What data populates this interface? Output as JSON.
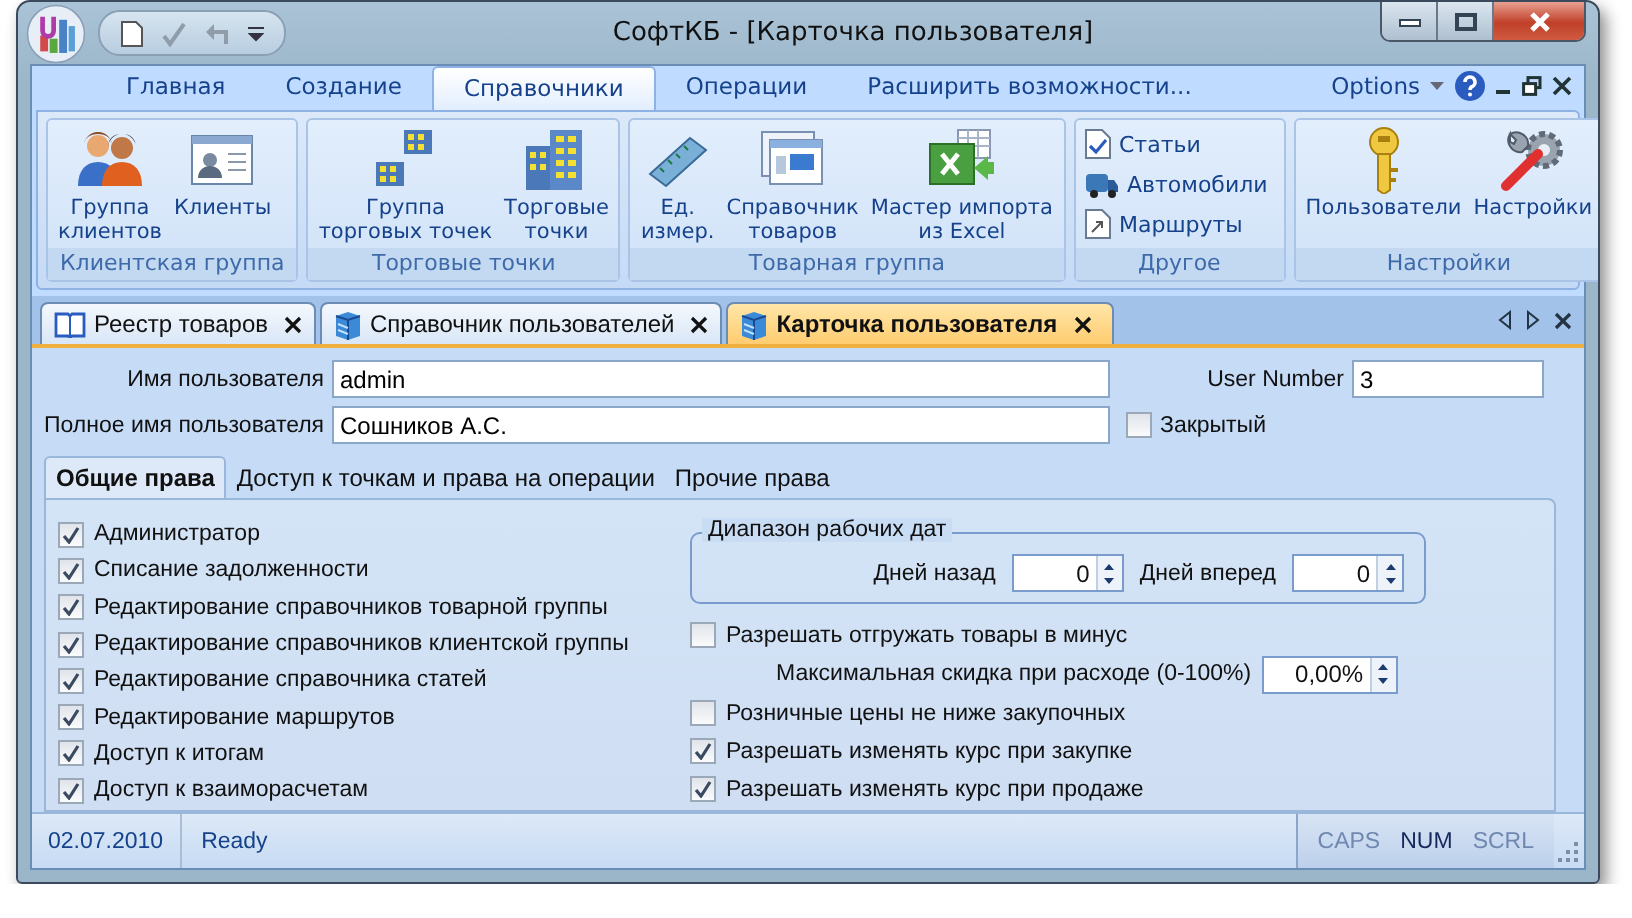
{
  "window": {
    "title": "СофтКБ - [Карточка пользователя]"
  },
  "ribbon_tabs": [
    {
      "label": "Главная",
      "selected": false
    },
    {
      "label": "Создание",
      "selected": false
    },
    {
      "label": "Справочники",
      "selected": true
    },
    {
      "label": "Операции",
      "selected": false
    },
    {
      "label": "Расширить возможности...",
      "selected": false
    }
  ],
  "options": {
    "label": "Options"
  },
  "ribbon_groups": [
    {
      "title": "Клиентская группа",
      "buttons": [
        {
          "kind": "large",
          "label": "Группа\nклиентов"
        },
        {
          "kind": "large",
          "label": "Клиенты"
        }
      ]
    },
    {
      "title": "Торговые точки",
      "buttons": [
        {
          "kind": "large",
          "label": "Группа\nторговых точек"
        },
        {
          "kind": "large",
          "label": "Торговые\nточки"
        }
      ]
    },
    {
      "title": "Товарная группа",
      "buttons": [
        {
          "kind": "large",
          "label": "Ед.\nизмер."
        },
        {
          "kind": "large",
          "label": "Справочник\nтоваров"
        },
        {
          "kind": "large",
          "label": "Мастер импорта\nиз Excel"
        }
      ]
    },
    {
      "title": "Другое",
      "buttons": [
        {
          "kind": "small",
          "label": "Статьи"
        },
        {
          "kind": "small",
          "label": "Автомобили"
        },
        {
          "kind": "small",
          "label": "Маршруты"
        }
      ]
    },
    {
      "title": "Настройки",
      "buttons": [
        {
          "kind": "large",
          "label": "Пользователи"
        },
        {
          "kind": "large",
          "label": "Настройки"
        }
      ]
    }
  ],
  "document_tabs": [
    {
      "label": "Реестр товаров",
      "selected": false
    },
    {
      "label": "Справочник пользователей",
      "selected": false
    },
    {
      "label": "Карточка пользователя",
      "selected": true
    }
  ],
  "form": {
    "user_name": {
      "label": "Имя пользователя",
      "value": "admin"
    },
    "user_number": {
      "label": "User Number",
      "value": "3"
    },
    "full_name": {
      "label": "Полное имя пользователя",
      "value": "Сошников А.С."
    },
    "closed": {
      "label": "Закрытый",
      "checked": false
    }
  },
  "sub_tabs": [
    {
      "label": "Общие права",
      "selected": true
    },
    {
      "label": "Доступ к точкам и права на операции",
      "selected": false
    },
    {
      "label": "Прочие права",
      "selected": false
    }
  ],
  "rights": [
    {
      "label": "Администратор",
      "checked": true
    },
    {
      "label": "Списание задолженности",
      "checked": true
    },
    {
      "label": "Редактирование справочников товарной группы",
      "checked": true
    },
    {
      "label": "Редактирование справочников клиентской группы",
      "checked": true
    },
    {
      "label": "Редактирование справочника статей",
      "checked": true
    },
    {
      "label": "Редактирование маршрутов",
      "checked": true
    },
    {
      "label": "Доступ к итогам",
      "checked": true
    },
    {
      "label": "Доступ к взаиморасчетам",
      "checked": true
    }
  ],
  "date_range": {
    "title": "Диапазон рабочих дат",
    "days_back": {
      "label": "Дней назад",
      "value": "0"
    },
    "days_forward": {
      "label": "Дней вперед",
      "value": "0"
    }
  },
  "options_list": [
    {
      "kind": "checkbox",
      "label": "Разрешать отгружать товары в минус",
      "checked": false
    },
    {
      "kind": "spinner",
      "label": "Максимальная скидка при расходе (0-100%)",
      "value": "0,00%"
    },
    {
      "kind": "checkbox",
      "label": "Розничные цены не ниже закупочных",
      "checked": false
    },
    {
      "kind": "checkbox",
      "label": "Разрешать изменять курс при закупке",
      "checked": true
    },
    {
      "kind": "checkbox",
      "label": "Разрешать изменять курс при продаже",
      "checked": true
    }
  ],
  "status_bar": {
    "date": "02.07.2010",
    "text": "Ready",
    "indicators": [
      {
        "label": "CAPS",
        "on": false
      },
      {
        "label": "NUM",
        "on": true
      },
      {
        "label": "SCRL",
        "on": false
      }
    ]
  }
}
